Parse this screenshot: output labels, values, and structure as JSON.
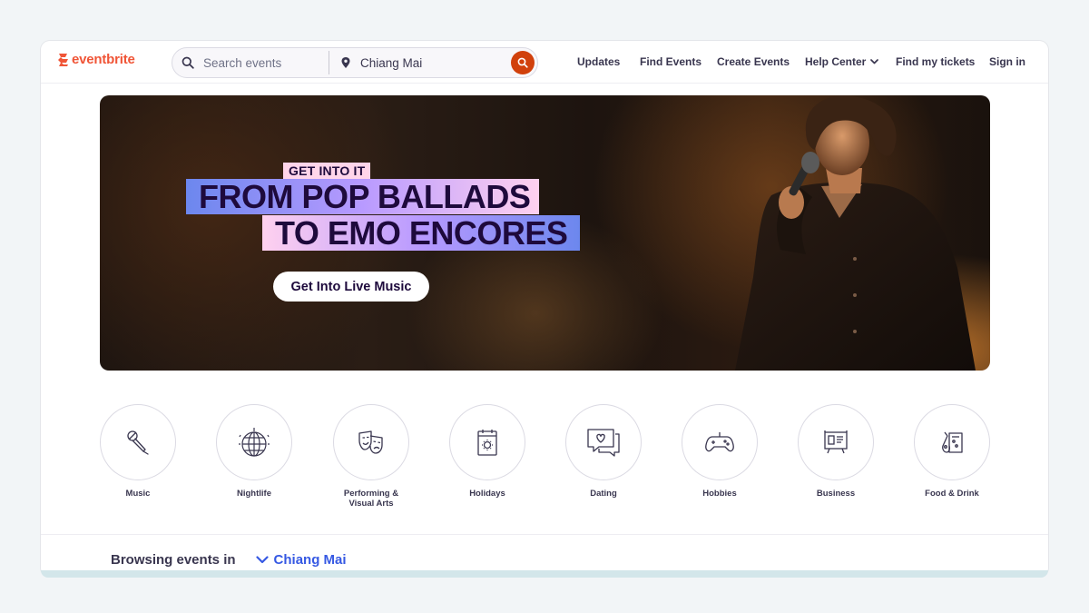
{
  "brand": {
    "name": "eventbrite",
    "color": "#f05537"
  },
  "search": {
    "placeholder": "Search events",
    "location": "Chiang Mai",
    "button_color": "#d1410c"
  },
  "nav": {
    "updates": "Updates",
    "find_events": "Find Events",
    "create_events": "Create Events",
    "help_center": "Help Center",
    "find_tickets": "Find my tickets",
    "sign_in": "Sign in"
  },
  "hero": {
    "kicker": "GET INTO IT",
    "headline_line1": "FROM POP BALLADS",
    "headline_line2": "TO EMO ENCORES",
    "cta": "Get Into Live Music"
  },
  "categories": [
    {
      "label": "Music",
      "icon": "microphone-icon"
    },
    {
      "label": "Nightlife",
      "icon": "disco-ball-icon"
    },
    {
      "label_line1": "Performing &",
      "label_line2": "Visual Arts",
      "icon": "theater-masks-icon"
    },
    {
      "label": "Holidays",
      "icon": "calendar-icon"
    },
    {
      "label": "Dating",
      "icon": "chat-heart-icon"
    },
    {
      "label": "Hobbies",
      "icon": "gamepad-icon"
    },
    {
      "label": "Business",
      "icon": "presentation-board-icon"
    },
    {
      "label": "Food & Drink",
      "icon": "drinks-icon"
    }
  ],
  "browsing": {
    "label": "Browsing events in",
    "location": "Chiang Mai",
    "accent": "#3659e3"
  }
}
